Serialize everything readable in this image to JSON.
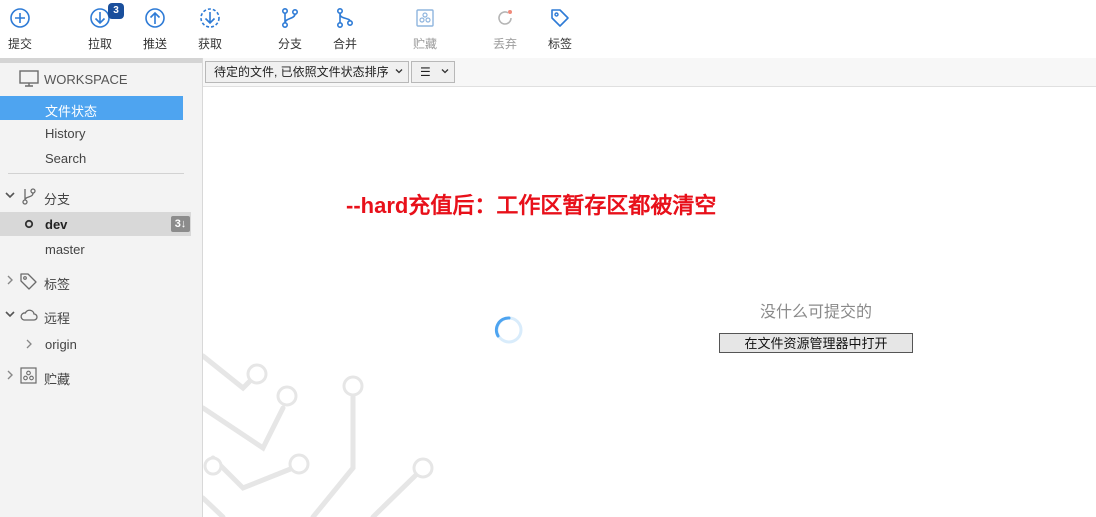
{
  "toolbar": {
    "commit": "提交",
    "pull": "拉取",
    "pull_badge": "3",
    "push": "推送",
    "fetch": "获取",
    "branch": "分支",
    "merge": "合并",
    "stash": "贮藏",
    "discard": "丢弃",
    "tag": "标签"
  },
  "sidebar": {
    "workspace": "WORKSPACE",
    "file_status": "文件状态",
    "history": "History",
    "search": "Search",
    "branches_head": "分支",
    "branch_dev": "dev",
    "branch_dev_badge": "3↓",
    "branch_master": "master",
    "tags_head": "标签",
    "remotes_head": "远程",
    "remote_origin": "origin",
    "stashes_head": "贮藏"
  },
  "main": {
    "sort_dropdown": "待定的文件, 已依照文件状态排序",
    "view_dropdown": "☰",
    "annotation": "--hard充值后：工作区暂存区都被清空",
    "empty_message": "没什么可提交的",
    "open_explorer_button": "在文件资源管理器中打开"
  },
  "colors": {
    "accent": "#4ea4f0",
    "badge": "#1a4f9c",
    "annotation": "#e8101a"
  }
}
